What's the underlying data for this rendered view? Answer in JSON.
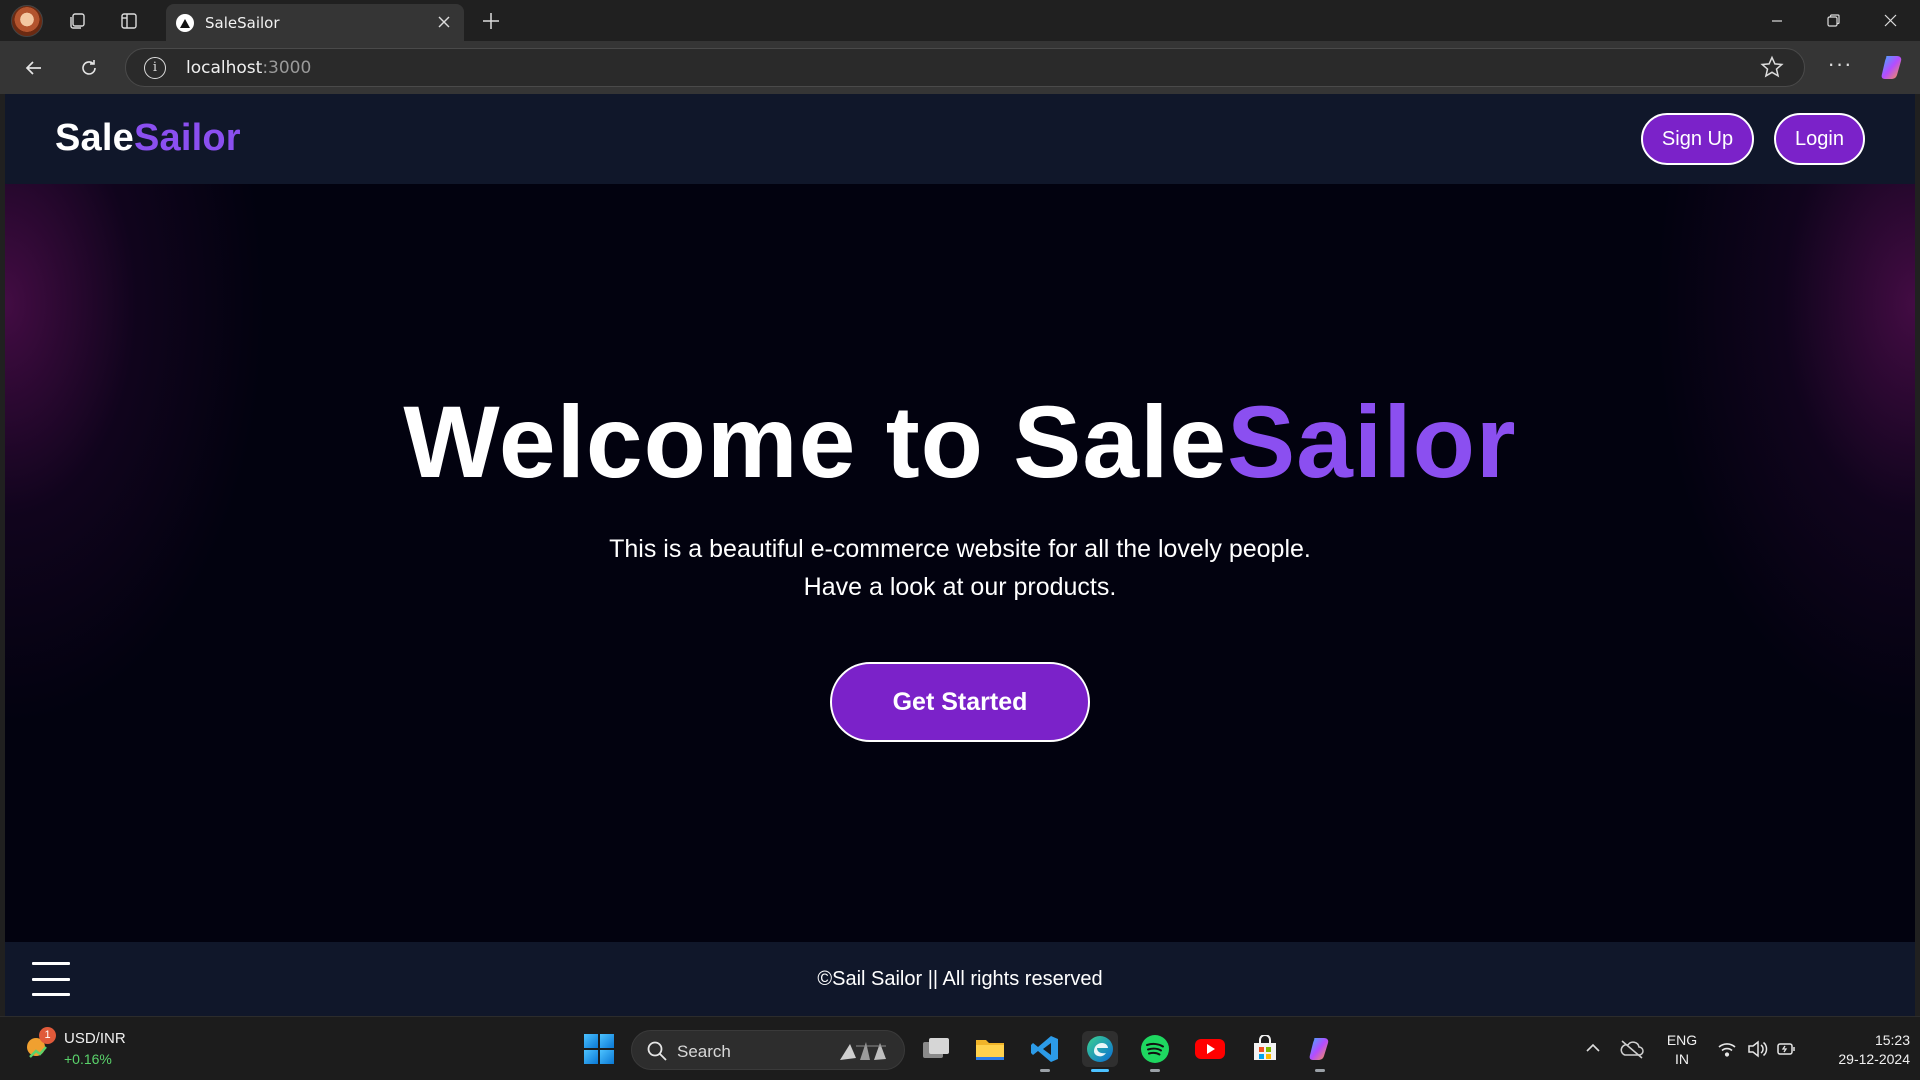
{
  "browser": {
    "tab_title": "SaleSailor",
    "url_host": "localhost",
    "url_port": ":3000"
  },
  "site": {
    "logo_part1": "Sale",
    "logo_part2": "Sailor",
    "signup_label": "Sign Up",
    "login_label": "Login",
    "hero_title_part1": "Welcome to Sale",
    "hero_title_part2": "Sailor",
    "hero_line1": "This is a beautiful e-commerce website for all the lovely people.",
    "hero_line2": "Have a look at our products.",
    "cta_label": "Get Started",
    "footer_text": "©Sail Sailor || All rights reserved",
    "colors": {
      "accent": "#8b4ff0",
      "button_bg": "#7b22c9",
      "header_bg": "#10172a",
      "page_bg": "#02020f"
    }
  },
  "taskbar": {
    "widget_title": "USD/INR",
    "widget_change": "+0.16%",
    "widget_badge": "1",
    "search_label": "Search",
    "apps": [
      "task-view-icon",
      "file-explorer-icon",
      "vscode-icon",
      "edge-icon",
      "spotify-icon",
      "youtube-icon",
      "microsoft-store-icon",
      "copilot-icon"
    ],
    "lang_line1": "ENG",
    "lang_line2": "IN",
    "time": "15:23",
    "date": "29-12-2024"
  }
}
